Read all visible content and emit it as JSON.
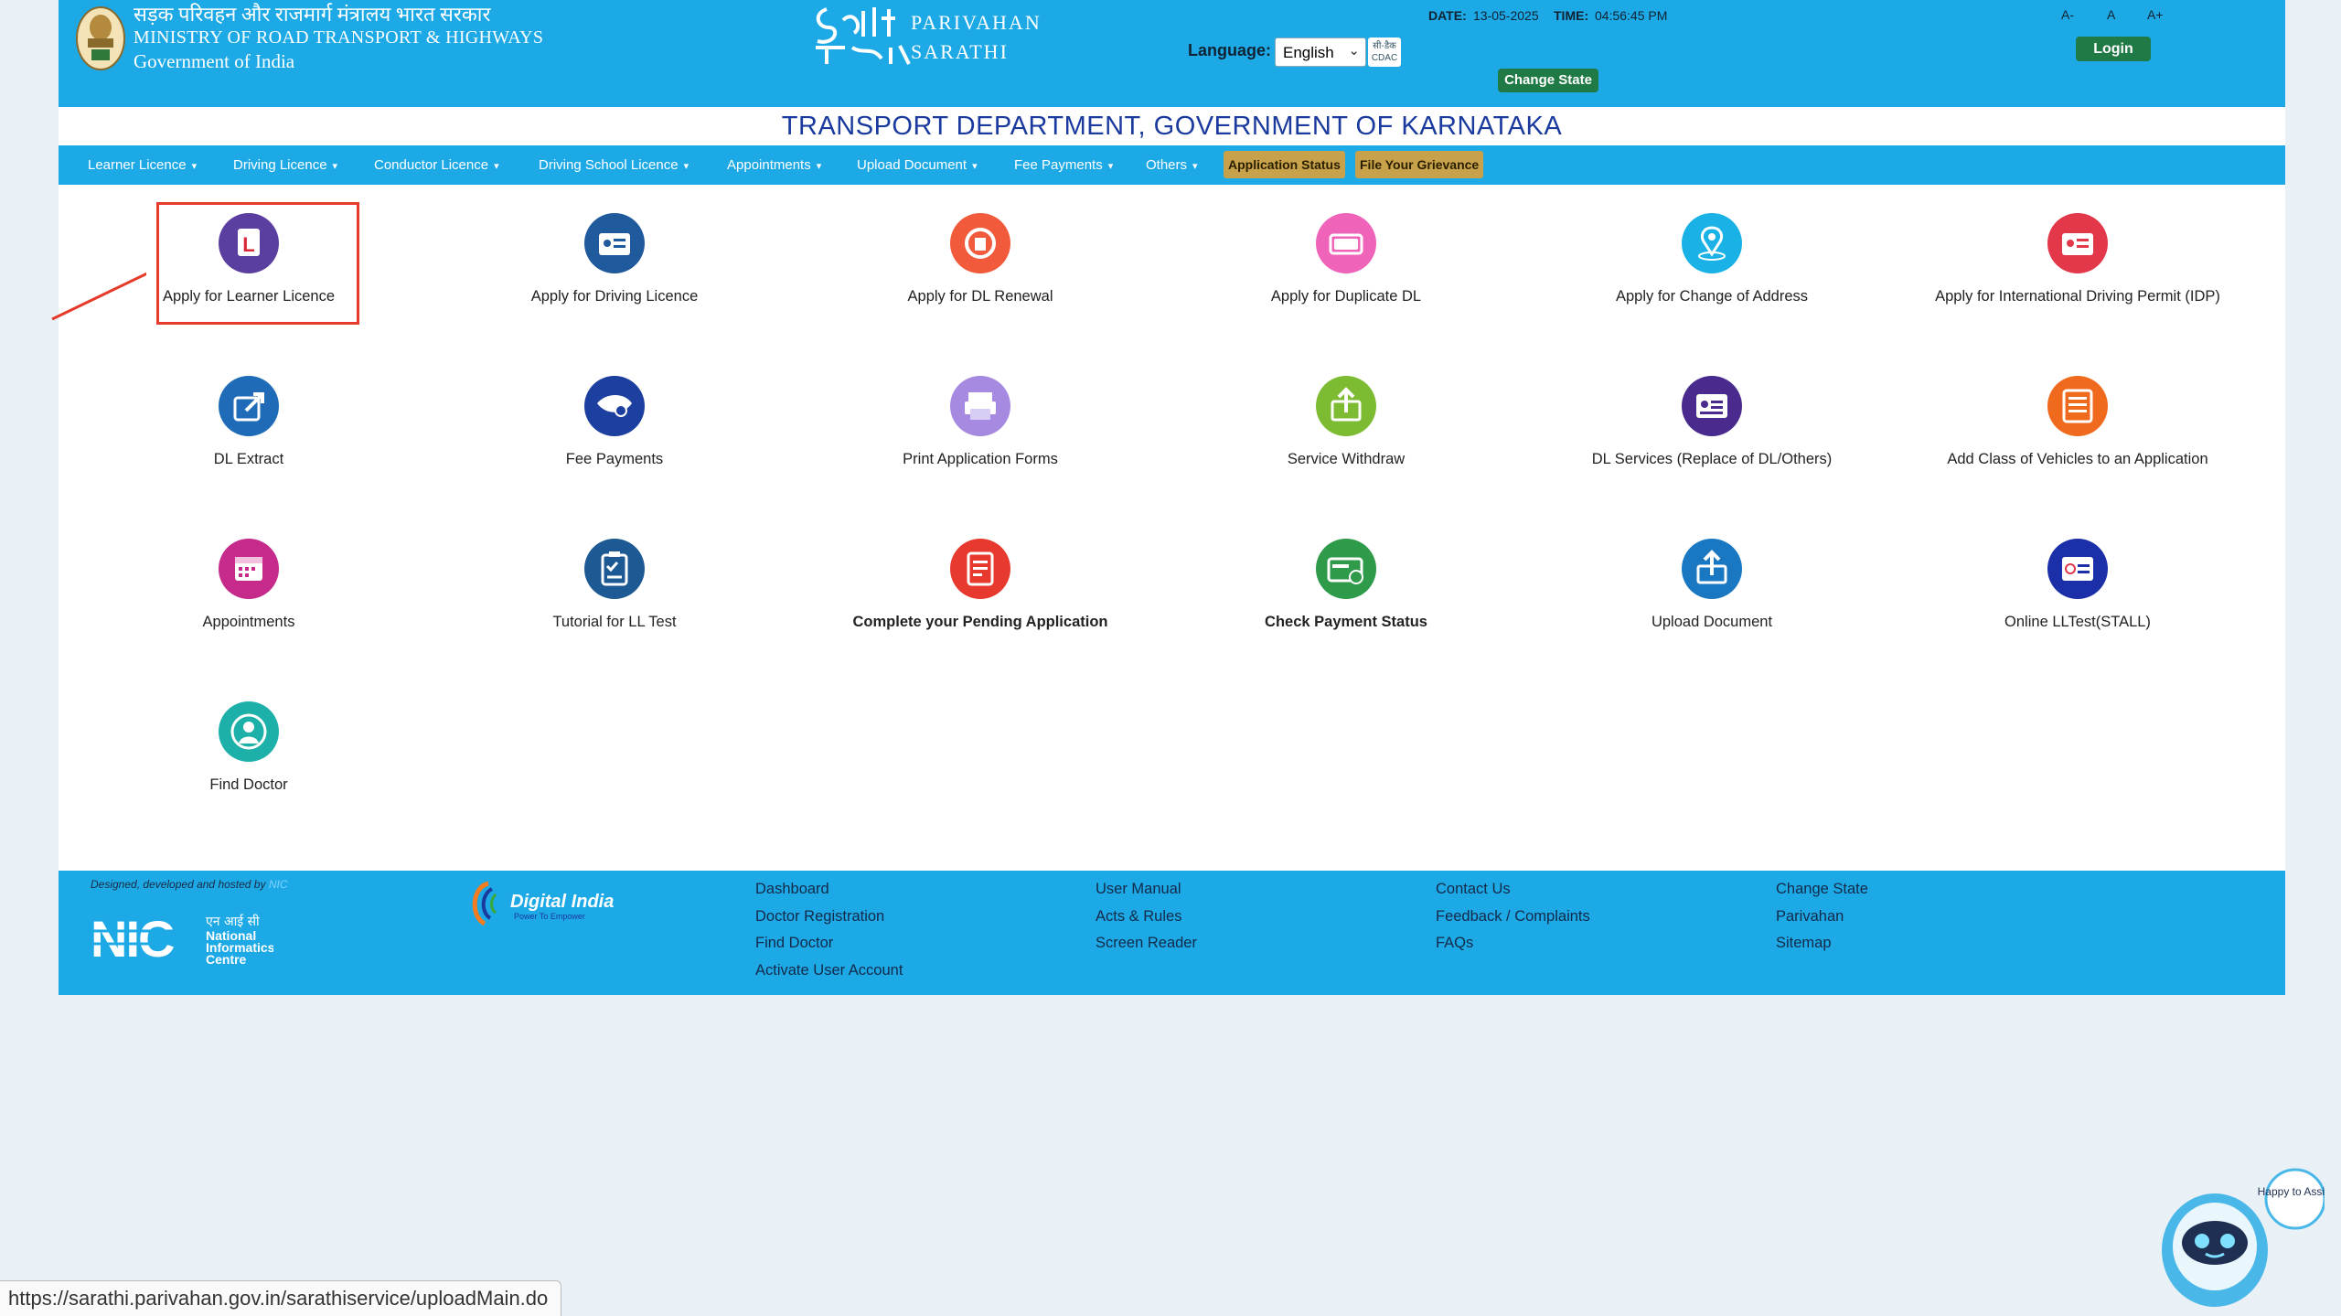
{
  "header": {
    "gov_hindi": "सड़क परिवहन और राजमार्ग मंत्रालय भारत सरकार",
    "ministry": "MINISTRY OF ROAD TRANSPORT & HIGHWAYS",
    "government": "Government of India",
    "brand_top": "PARIVAHAN",
    "brand_bottom": "SARATHI",
    "language_label": "Language:",
    "language_selected": "English",
    "date_label": "DATE:",
    "date_value": "13-05-2025",
    "time_label": "TIME:",
    "time_value": "04:56:45 PM",
    "change_state": "Change State",
    "font_small": "A-",
    "font_normal": "A",
    "font_large": "A+",
    "login": "Login"
  },
  "department_title": "TRANSPORT DEPARTMENT, GOVERNMENT OF KARNATAKA",
  "nav": {
    "items": [
      {
        "label": "Learner Licence"
      },
      {
        "label": "Driving Licence"
      },
      {
        "label": "Conductor Licence"
      },
      {
        "label": "Driving School Licence"
      },
      {
        "label": "Appointments"
      },
      {
        "label": "Upload Document"
      },
      {
        "label": "Fee Payments"
      },
      {
        "label": "Others"
      }
    ],
    "application_status": "Application Status",
    "file_grievance": "File Your Grievance"
  },
  "services": [
    {
      "label": "Apply for Learner Licence",
      "icon": "learner-licence-icon",
      "color": "#5b3fa0"
    },
    {
      "label": "Apply for Driving Licence",
      "icon": "driving-licence-icon",
      "color": "#1f5a9c"
    },
    {
      "label": "Apply for DL Renewal",
      "icon": "dl-renewal-icon",
      "color": "#f15a3a"
    },
    {
      "label": "Apply for Duplicate DL",
      "icon": "duplicate-dl-icon",
      "color": "#ef63b8"
    },
    {
      "label": "Apply for Change of Address",
      "icon": "change-address-icon",
      "color": "#1ab1e6"
    },
    {
      "label": "Apply for International Driving Permit (IDP)",
      "icon": "idp-icon",
      "color": "#e2384a"
    },
    {
      "label": "DL Extract",
      "icon": "dl-extract-icon",
      "color": "#1f6bb8"
    },
    {
      "label": "Fee Payments",
      "icon": "fee-payments-icon",
      "color": "#1c3fa0"
    },
    {
      "label": "Print Application Forms",
      "icon": "print-forms-icon",
      "color": "#a689e0"
    },
    {
      "label": "Service Withdraw",
      "icon": "service-withdraw-icon",
      "color": "#7dbb32"
    },
    {
      "label": "DL Services (Replace of DL/Others)",
      "icon": "dl-services-icon",
      "color": "#4a2a8c"
    },
    {
      "label": "Add Class of Vehicles to an Application",
      "icon": "add-class-icon",
      "color": "#f06a1e"
    },
    {
      "label": "Appointments",
      "icon": "appointments-calendar-icon",
      "color": "#c62a8a"
    },
    {
      "label": "Tutorial for LL Test",
      "icon": "tutorial-clipboard-icon",
      "color": "#1d5a94"
    },
    {
      "label": "Complete your Pending Application",
      "icon": "pending-application-icon",
      "color": "#e8392e"
    },
    {
      "label": "Check Payment Status",
      "icon": "payment-status-icon",
      "color": "#2e9a4a"
    },
    {
      "label": "Upload Document",
      "icon": "upload-document-icon",
      "color": "#1a78c2"
    },
    {
      "label": "Online LLTest(STALL)",
      "icon": "online-lltest-icon",
      "color": "#1a2fa8"
    },
    {
      "label": "Find Doctor",
      "icon": "find-doctor-icon",
      "color": "#1db0a8"
    }
  ],
  "footer": {
    "credit_prefix": "Designed, developed and hosted by",
    "credit_org": "NIC",
    "nic_hindi": "एन आई सी",
    "nic_line1": "National",
    "nic_line2": "Informatics",
    "nic_line3": "Centre",
    "digital_india": "Digital India",
    "digital_india_tagline": "Power To Empower",
    "col1": [
      "Dashboard",
      "Doctor Registration",
      "Find Doctor",
      "Activate User Account"
    ],
    "col2": [
      "User Manual",
      "Acts & Rules",
      "Screen Reader"
    ],
    "col3": [
      "Contact Us",
      "Feedback / Complaints",
      "FAQs"
    ],
    "col4": [
      "Change State",
      "Parivahan",
      "Sitemap"
    ]
  },
  "status_url": "https://sarathi.parivahan.gov.in/sarathiservice/uploadMain.do",
  "chatbot_bubble": "Happy to Assist",
  "cdac_logo": "सी-डैक CDAC",
  "colors": {
    "header_blue": "#1ca9e6",
    "title_blue": "#1a3a9e",
    "button_green": "#1f7a46",
    "highlight_red": "#e63b2a",
    "nav_gold": "#c7a24a"
  }
}
